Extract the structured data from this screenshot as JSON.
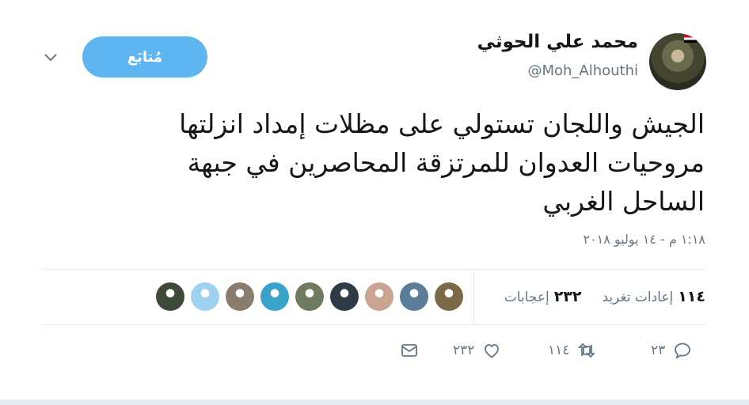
{
  "author": {
    "name": "محمد علي الحوثي",
    "handle": "@Moh_Alhouthi"
  },
  "follow_button": "مُتابَع",
  "tweet": {
    "text": "الجيش واللجان تستولي على مظلات إمداد انزلتها\nمروحيات العدوان للمرتزقة المحاصرين في جبهة\nالساحل الغربي",
    "timestamp": "١:١٨ م - ١٤ يوليو ٢٠١٨"
  },
  "stats": {
    "retweets_count": "١١٤",
    "retweets_label": "إعادات تغريد",
    "likes_count": "٢٣٢",
    "likes_label": "إعجابات"
  },
  "likers": [
    {
      "icon": "avatar-photo",
      "color": "#7a6a48"
    },
    {
      "icon": "avatar-photo",
      "color": "#5b7d9a"
    },
    {
      "icon": "avatar-photo",
      "color": "#c9a591"
    },
    {
      "icon": "avatar-photo",
      "color": "#2e3a46"
    },
    {
      "icon": "avatar-photo",
      "color": "#6f7a5e"
    },
    {
      "icon": "avatar-photo",
      "color": "#39a2c9"
    },
    {
      "icon": "avatar-photo",
      "color": "#8a7d6e"
    },
    {
      "icon": "avatar-photo",
      "color": "#9fd1f0"
    },
    {
      "icon": "avatar-photo",
      "color": "#3d4a3a"
    }
  ],
  "actions": {
    "reply_count": "٢٣",
    "retweet_count": "١١٤",
    "like_count": "٢٣٢"
  },
  "colors": {
    "accent": "#5eb5f0",
    "muted": "#657786",
    "divider": "#e6ecf0"
  }
}
